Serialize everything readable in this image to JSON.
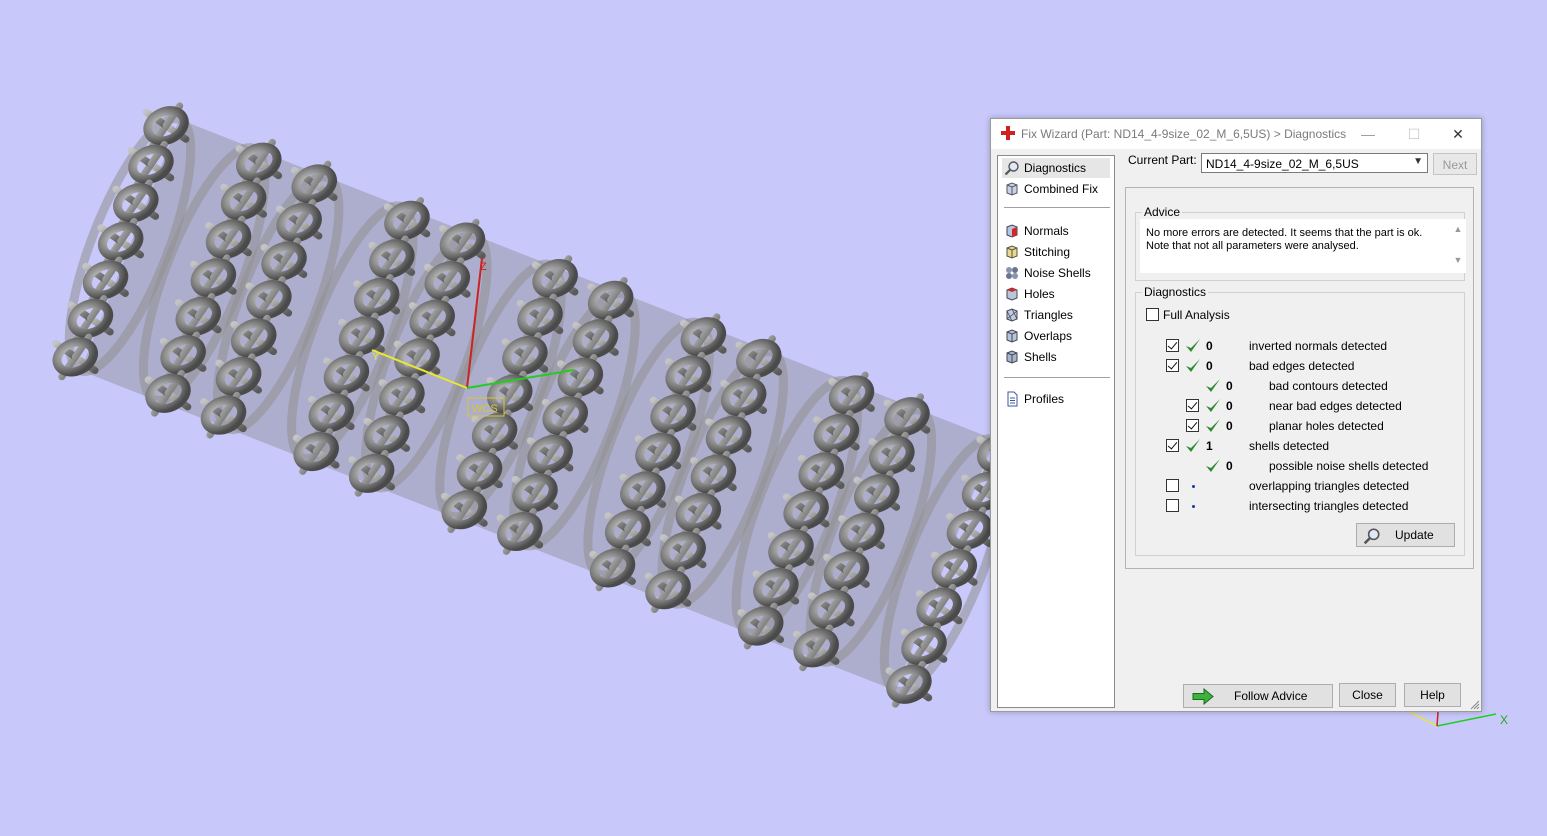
{
  "window": {
    "title": "Fix Wizard (Part: ND14_4-9size_02_M_6,5US) > Diagnostics",
    "minimize": "—",
    "maximize": "☐",
    "close": "✕"
  },
  "viewport": {
    "wcs_label": "WCS",
    "axis_y": "Y",
    "axis_z": "Z",
    "mini_axis_x": "X",
    "background": "#c8c8fa"
  },
  "nav": {
    "items": [
      {
        "label": "Diagnostics",
        "icon": "magnifier-icon"
      },
      {
        "label": "Combined Fix",
        "icon": "cube-icon"
      },
      {
        "label": "Normals",
        "icon": "normals-cube-icon"
      },
      {
        "label": "Stitching",
        "icon": "stitching-cube-icon"
      },
      {
        "label": "Noise Shells",
        "icon": "noise-shells-icon"
      },
      {
        "label": "Holes",
        "icon": "holes-cube-icon"
      },
      {
        "label": "Triangles",
        "icon": "triangles-cube-icon"
      },
      {
        "label": "Overlaps",
        "icon": "overlaps-cube-icon"
      },
      {
        "label": "Shells",
        "icon": "shells-cube-icon"
      },
      {
        "label": "Profiles",
        "icon": "document-icon"
      }
    ]
  },
  "current_part": {
    "label": "Current Part:",
    "value": "ND14_4-9size_02_M_6,5US",
    "next_label": "Next"
  },
  "advice": {
    "title": "Advice",
    "line1": "No more errors are detected. It seems that the part is ok.",
    "line2": "Note that not all parameters were analysed."
  },
  "diagnostics": {
    "title": "Diagnostics",
    "full_analysis_label": "Full Analysis",
    "full_analysis_checked": false,
    "rows": [
      {
        "checkbox": true,
        "checked": true,
        "ok": true,
        "count": "0",
        "label": "inverted normals detected"
      },
      {
        "checkbox": true,
        "checked": true,
        "ok": true,
        "count": "0",
        "label": "bad edges detected"
      },
      {
        "checkbox": false,
        "checked": false,
        "ok": true,
        "count": "0",
        "label": "bad contours detected"
      },
      {
        "checkbox": true,
        "checked": true,
        "ok": true,
        "count": "0",
        "label": "near bad edges detected"
      },
      {
        "checkbox": true,
        "checked": true,
        "ok": true,
        "count": "0",
        "label": "planar holes detected"
      },
      {
        "checkbox": true,
        "checked": true,
        "ok": true,
        "count": "1",
        "label": "shells detected"
      },
      {
        "checkbox": false,
        "checked": false,
        "ok": true,
        "count": "0",
        "label": "possible noise shells detected"
      },
      {
        "checkbox": true,
        "checked": false,
        "ok": false,
        "count": "",
        "label": "overlapping triangles detected"
      },
      {
        "checkbox": true,
        "checked": false,
        "ok": false,
        "count": "",
        "label": "intersecting triangles detected"
      }
    ],
    "update_label": "Update"
  },
  "footer": {
    "follow_advice_label": "Follow Advice",
    "close_label": "Close",
    "help_label": "Help"
  },
  "colors": {
    "ok_check": "#2e8b2e",
    "axis_red": "#cc2222",
    "axis_green": "#22cc22",
    "axis_yellow": "#e8e830"
  }
}
